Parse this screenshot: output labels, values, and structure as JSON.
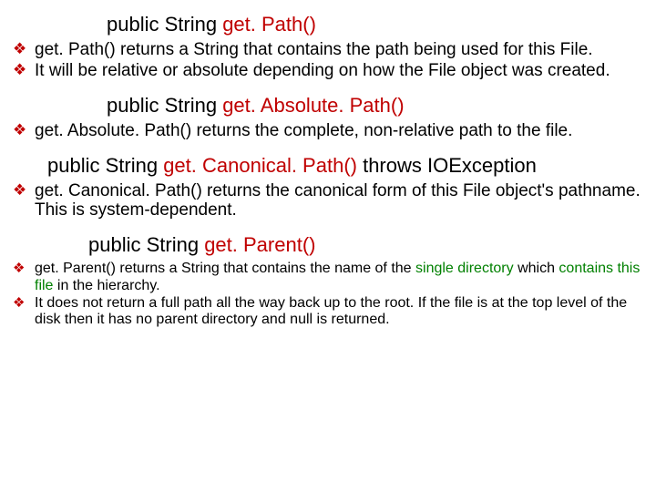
{
  "sections": [
    {
      "heading_prefix": "public String ",
      "heading_method": "get. Path()",
      "heading_class": "h1",
      "bullets_size": "",
      "bullets": [
        {
          "html": "get. Path() returns a String that contains the path being used for this File."
        },
        {
          "html": "It will be relative or absolute depending on how the File object was created."
        }
      ]
    },
    {
      "heading_prefix": "public String ",
      "heading_method": "get. Absolute. Path()",
      "heading_class": "h2",
      "bullets_size": "",
      "bullets": [
        {
          "html": "get. Absolute. Path() returns the complete, non-relative path to the file."
        }
      ]
    },
    {
      "heading_prefix": "public String ",
      "heading_method": "get. Canonical. Path()",
      "heading_suffix": " throws IOException",
      "heading_class": "h3",
      "bullets_size": "",
      "bullets": [
        {
          "html": "get. Canonical. Path() returns the canonical form of this File object's pathname. This is system-dependent."
        }
      ]
    },
    {
      "heading_prefix": "public String ",
      "heading_method": "get. Parent()",
      "heading_class": "h4",
      "bullets_size": "small",
      "bullets": [
        {
          "html": "get. Parent() returns a String that contains the name of the <span class=\"green\">single directory</span> which <span class=\"green\">contains this file</span> in the hierarchy."
        },
        {
          "html": " It does not return a full path all the way back up to the root. If the file is at the top level of the disk then it has no parent directory and null is returned."
        }
      ]
    }
  ]
}
